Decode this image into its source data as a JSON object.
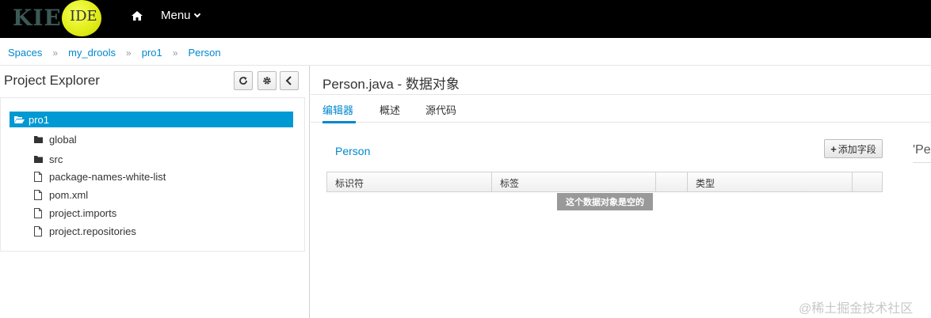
{
  "header": {
    "logo_kie": "KIE",
    "logo_ide": "IDE",
    "menu_label": "Menu"
  },
  "breadcrumb": [
    "Spaces",
    "my_drools",
    "pro1",
    "Person"
  ],
  "project_explorer": {
    "title": "Project Explorer",
    "tree": {
      "selected": "pro1",
      "items": [
        {
          "label": "global",
          "type": "folder"
        },
        {
          "label": "src",
          "type": "folder"
        },
        {
          "label": "package-names-white-list",
          "type": "file"
        },
        {
          "label": "pom.xml",
          "type": "file"
        },
        {
          "label": "project.imports",
          "type": "file"
        },
        {
          "label": "project.repositories",
          "type": "file"
        }
      ]
    }
  },
  "editor": {
    "title": "Person.java - 数据对象",
    "tabs": [
      "编辑器",
      "概述",
      "源代码"
    ],
    "active_tab": 0,
    "object_name": "Person",
    "add_field_label": "添加字段",
    "columns": [
      "标识符",
      "标签",
      "",
      "类型",
      ""
    ],
    "empty_message": "这个数据对象是空的",
    "side_peek": "'Pe"
  },
  "watermark": "@稀土掘金技术社区",
  "colors": {
    "accent": "#0088ce",
    "selection": "#0099d3",
    "topbar": "#000000"
  }
}
